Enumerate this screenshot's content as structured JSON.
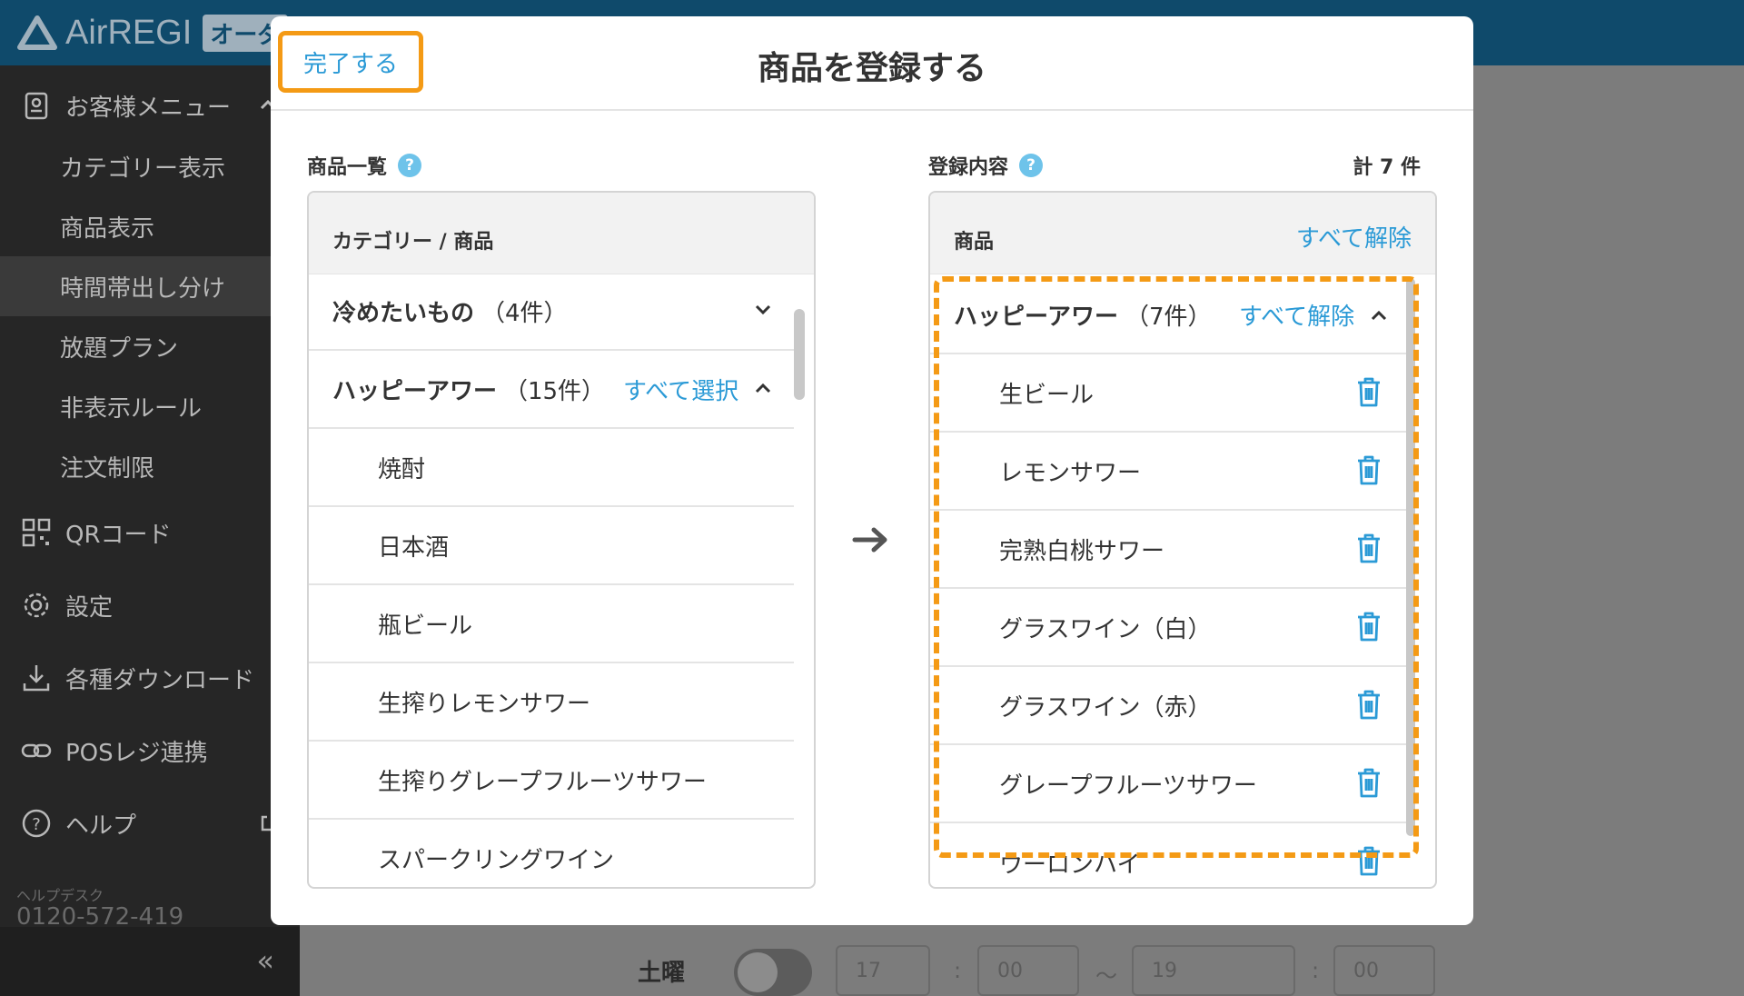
{
  "app": {
    "logo_text": "AirREGI",
    "logo_badge": "オーダ"
  },
  "sidebar": {
    "menu_title": "お客様メニュー",
    "sub_items": [
      "カテゴリー表示",
      "商品表示",
      "時間帯出し分け",
      "放題プラン",
      "非表示ルール",
      "注文制限"
    ],
    "active_sub": "時間帯出し分け",
    "items": {
      "qr": "QRコード",
      "settings": "設定",
      "download": "各種ダウンロード",
      "pos": "POSレジ連携",
      "help": "ヘルプ"
    },
    "helpdesk_label": "ヘルプデスク",
    "helpdesk_phone": "0120-572-419",
    "collapse_icon": "«"
  },
  "background": {
    "day_label": "土曜",
    "time_selects": [
      "17",
      "00",
      "19",
      "00"
    ],
    "colon": ":",
    "tilde": "〜"
  },
  "modal": {
    "done_label": "完了する",
    "title": "商品を登録する",
    "left": {
      "section_label": "商品一覧",
      "header": "カテゴリー / 商品",
      "categories": [
        {
          "name": "冷めたいもの",
          "count": "（4件）"
        },
        {
          "name": "ハッピーアワー",
          "count": "（15件）",
          "action": "すべて選択"
        }
      ],
      "items": [
        "焼酎",
        "日本酒",
        "瓶ビール",
        "生搾りレモンサワー",
        "生搾りグレープフルーツサワー",
        "スパークリングワイン"
      ]
    },
    "right": {
      "section_label": "登録内容",
      "total": "計 7 件",
      "header": "商品",
      "clear_all": "すべて解除",
      "group": {
        "name": "ハッピーアワー",
        "count": "（7件）",
        "action": "すべて解除"
      },
      "items": [
        "生ビール",
        "レモンサワー",
        "完熟白桃サワー",
        "グラスワイン（白）",
        "グラスワイン（赤）",
        "グレープフルーツサワー",
        "ウーロンハイ"
      ]
    },
    "help_glyph": "?"
  },
  "colors": {
    "accent_blue": "#2b9ad6",
    "highlight_orange": "#f49a15",
    "sidebar_bg": "#262626",
    "topbar_bg": "#0f4a6b"
  }
}
